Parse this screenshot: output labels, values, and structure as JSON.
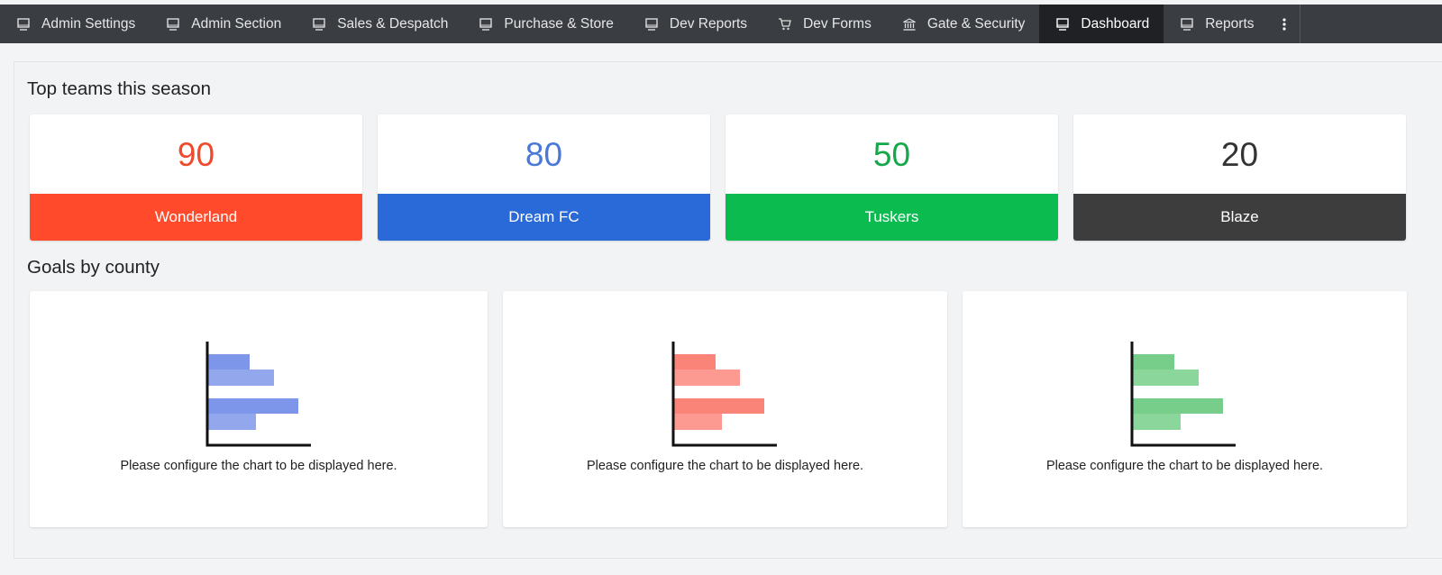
{
  "nav": {
    "items": [
      {
        "label": "Admin Settings",
        "icon": "monitor-icon"
      },
      {
        "label": "Admin Section",
        "icon": "monitor-icon"
      },
      {
        "label": "Sales & Despatch",
        "icon": "monitor-icon"
      },
      {
        "label": "Purchase & Store",
        "icon": "monitor-icon"
      },
      {
        "label": "Dev Reports",
        "icon": "monitor-icon"
      },
      {
        "label": "Dev Forms",
        "icon": "cart-icon"
      },
      {
        "label": "Gate & Security",
        "icon": "bank-icon"
      },
      {
        "label": "Dashboard",
        "icon": "monitor-icon",
        "active": true
      },
      {
        "label": "Reports",
        "icon": "monitor-icon"
      }
    ],
    "more_icon": "vertical-ellipsis-icon"
  },
  "top_teams": {
    "title": "Top teams this season",
    "cards": [
      {
        "value": "90",
        "label": "Wonderland",
        "color": "#ff4b2b"
      },
      {
        "value": "80",
        "label": "Dream FC",
        "color": "#2a69d8"
      },
      {
        "value": "50",
        "label": "Tuskers",
        "color": "#0bbb50"
      },
      {
        "value": "20",
        "label": "Blaze",
        "color": "#3d3d3d"
      }
    ],
    "value_colors": [
      "#f04a2d",
      "#4a78d6",
      "#15a84a",
      "#333333"
    ]
  },
  "goals": {
    "title": "Goals by county",
    "charts": [
      {
        "message": "Please configure the chart to be displayed here.",
        "color": "#8099e8",
        "icon": "placeholder-bar-chart-icon"
      },
      {
        "message": "Please configure the chart to be displayed here.",
        "color": "#fb887d",
        "icon": "placeholder-bar-chart-icon"
      },
      {
        "message": "Please configure the chart to be displayed here.",
        "color": "#7cd08f",
        "icon": "placeholder-bar-chart-icon"
      }
    ]
  }
}
